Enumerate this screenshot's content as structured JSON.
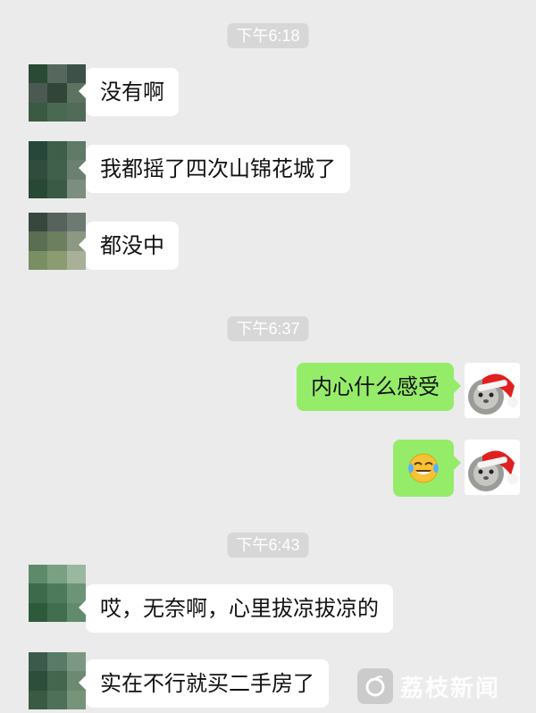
{
  "chat": {
    "timestamps": [
      "下午6:18",
      "下午6:37",
      "下午6:43"
    ],
    "messages": [
      {
        "side": "left",
        "text": "没有啊"
      },
      {
        "side": "left",
        "text": "我都摇了四次山锦花城了"
      },
      {
        "side": "left",
        "text": "都没中"
      },
      {
        "side": "right",
        "text": "内心什么感受"
      },
      {
        "side": "right",
        "emoji": "crying-laughing-emoji"
      },
      {
        "side": "left",
        "text": "哎，无奈啊，心里拔凉拔凉的"
      },
      {
        "side": "left",
        "text": "实在不行就买二手房了"
      }
    ]
  },
  "watermark": {
    "text": "荔枝新闻"
  },
  "colors": {
    "background": "#ebebeb",
    "left_bubble": "#ffffff",
    "right_bubble": "#95ec69",
    "timestamp_bg": "#d7d7d7"
  }
}
